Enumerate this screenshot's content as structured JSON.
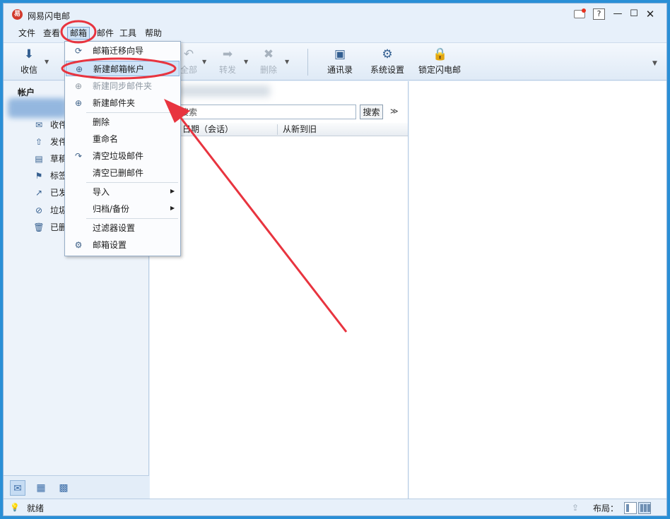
{
  "window": {
    "app_icon": "易",
    "title": "网易闪电邮",
    "controls": {
      "help": "?",
      "minimize": "—",
      "maximize": "☐",
      "close": "✕"
    }
  },
  "menubar": {
    "items": [
      "文件",
      "查看",
      "邮箱",
      "邮件",
      "工具",
      "帮助"
    ],
    "active": "邮箱"
  },
  "toolbar": {
    "items": [
      {
        "label": "收信",
        "icon": "download-icon",
        "glyph": "⬇",
        "enabled": true
      },
      {
        "label": "全部",
        "icon": "reply-all-icon",
        "glyph": "↶",
        "enabled": false
      },
      {
        "label": "转发",
        "icon": "forward-icon",
        "glyph": "➡",
        "enabled": false
      },
      {
        "label": "删除",
        "icon": "delete-icon",
        "glyph": "✖",
        "enabled": false
      },
      {
        "label": "通讯录",
        "icon": "contacts-icon",
        "glyph": "▣",
        "enabled": true
      },
      {
        "label": "系统设置",
        "icon": "gear-icon",
        "glyph": "⚙",
        "enabled": true
      },
      {
        "label": "锁定闪电邮",
        "icon": "lock-icon",
        "glyph": "🔒",
        "enabled": true
      }
    ]
  },
  "left_pane": {
    "header": "帐户",
    "folders": [
      {
        "label": "收件",
        "icon": "inbox-icon",
        "glyph": "✉"
      },
      {
        "label": "发件",
        "icon": "outbox-icon",
        "glyph": "⇧"
      },
      {
        "label": "草稿",
        "icon": "draft-icon",
        "glyph": "▤"
      },
      {
        "label": "标签",
        "icon": "flag-icon",
        "glyph": "⚑"
      },
      {
        "label": "已发",
        "icon": "sent-icon",
        "glyph": "↗"
      },
      {
        "label": "垃圾",
        "icon": "junk-icon",
        "glyph": "⊘"
      },
      {
        "label": "已删",
        "icon": "trash-icon",
        "glyph": "🗑"
      }
    ],
    "bottom_icons": [
      {
        "icon": "mail-view-icon",
        "glyph": "✉",
        "active": true
      },
      {
        "icon": "calendar-icon",
        "glyph": "▦",
        "active": false
      },
      {
        "icon": "apps-icon",
        "glyph": "▩",
        "active": false
      }
    ]
  },
  "mid_pane": {
    "search": {
      "value": "搜索",
      "button": "搜索",
      "expand": "≫"
    },
    "columns": [
      "日期（会话）",
      "从新到旧"
    ]
  },
  "dropdown": {
    "items": [
      {
        "label": "邮箱迁移向导",
        "icon": "migrate-icon",
        "glyph": "⟳",
        "disabled": false,
        "highlight": false,
        "submenu": false
      },
      {
        "label": "新建邮箱帐户",
        "icon": "new-account-icon",
        "glyph": "⊕",
        "disabled": false,
        "highlight": true,
        "submenu": false
      },
      {
        "label": "新建同步邮件夹",
        "icon": "new-sync-folder-icon",
        "glyph": "⊕",
        "disabled": true,
        "highlight": false,
        "submenu": false
      },
      {
        "label": "新建邮件夹",
        "icon": "new-folder-icon",
        "glyph": "⊕",
        "disabled": false,
        "highlight": false,
        "submenu": false
      },
      {
        "label": "删除",
        "icon": "",
        "glyph": "",
        "disabled": false,
        "highlight": false,
        "submenu": false
      },
      {
        "label": "重命名",
        "icon": "",
        "glyph": "",
        "disabled": false,
        "highlight": false,
        "submenu": false
      },
      {
        "label": "清空垃圾邮件",
        "icon": "empty-junk-icon",
        "glyph": "↷",
        "disabled": false,
        "highlight": false,
        "submenu": false
      },
      {
        "label": "清空已删邮件",
        "icon": "",
        "glyph": "",
        "disabled": false,
        "highlight": false,
        "submenu": false
      },
      {
        "label": "导入",
        "icon": "",
        "glyph": "",
        "disabled": false,
        "highlight": false,
        "submenu": true
      },
      {
        "label": "归档/备份",
        "icon": "",
        "glyph": "",
        "disabled": false,
        "highlight": false,
        "submenu": true
      },
      {
        "label": "过滤器设置",
        "icon": "",
        "glyph": "",
        "disabled": false,
        "highlight": false,
        "submenu": false
      },
      {
        "label": "邮箱设置",
        "icon": "mailbox-settings-icon",
        "glyph": "⚙",
        "disabled": false,
        "highlight": false,
        "submenu": false
      }
    ]
  },
  "statusbar": {
    "text": "就绪",
    "layout_label": "布局："
  },
  "colors": {
    "annotation": "#e8343f",
    "selection": "#d0e4f8",
    "pane_background": "#edf3fa"
  }
}
